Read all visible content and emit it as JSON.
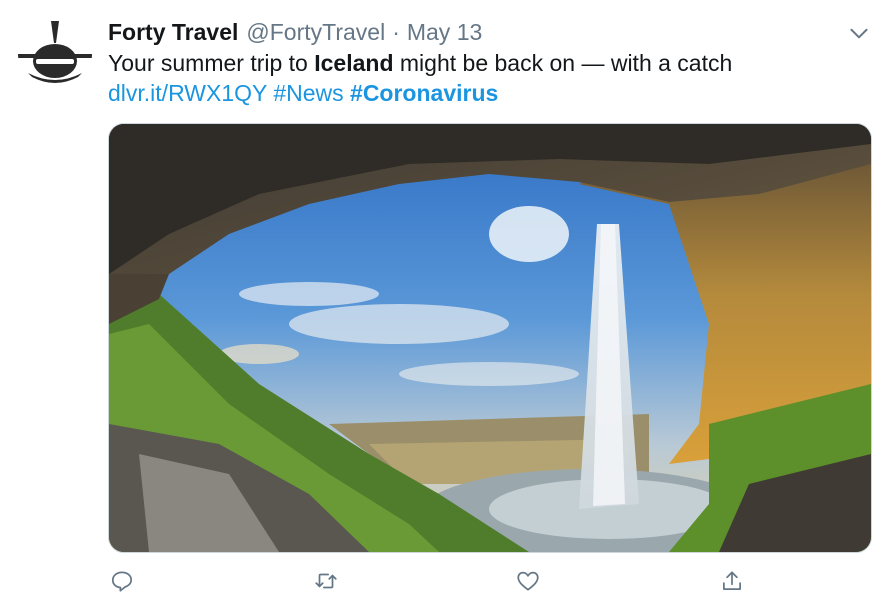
{
  "tweet": {
    "author_name": "Forty Travel",
    "handle": "@FortyTravel",
    "separator": "·",
    "date": "May 13",
    "text_before": "Your summer trip to ",
    "text_bold": "Iceland",
    "text_after": " might be back on — with a catch",
    "link_url": "dlvr.it/RWX1QY",
    "hashtag_1": "#News",
    "hashtag_2": "#Coronavirus"
  },
  "icons": {
    "avatar": "airplane-logo-icon",
    "menu": "chevron-down-icon",
    "reply": "reply-icon",
    "retweet": "retweet-icon",
    "like": "heart-icon",
    "share": "share-icon"
  },
  "colors": {
    "text": "#14171a",
    "muted": "#657786",
    "link": "#1b95e0",
    "border": "#ccd6dd"
  }
}
